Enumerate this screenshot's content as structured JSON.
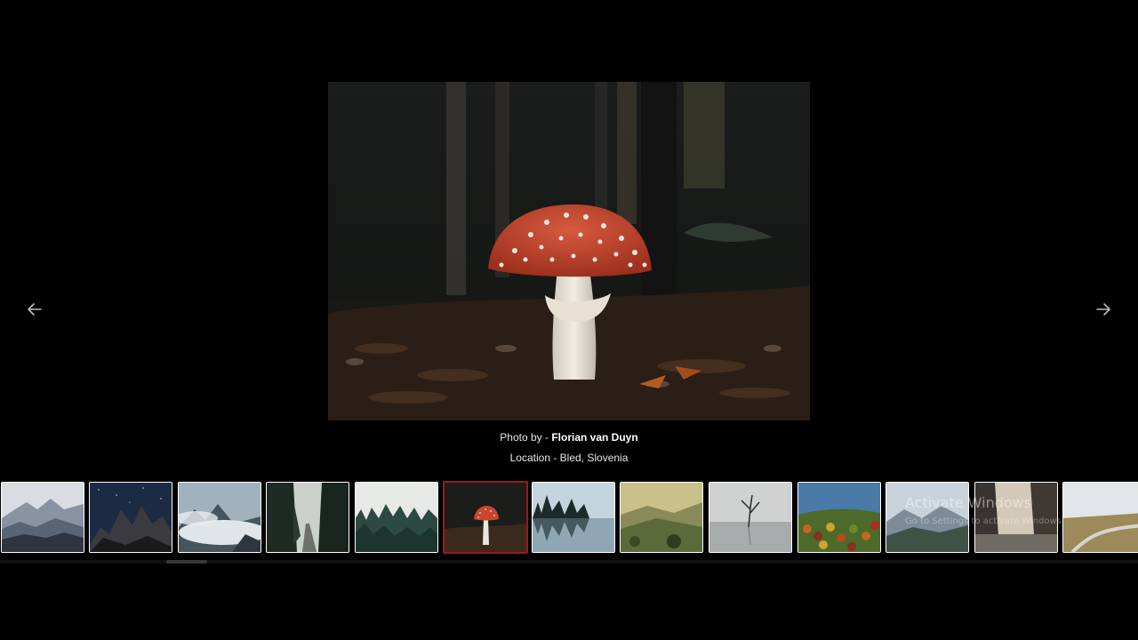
{
  "caption": {
    "credit_prefix": "Photo by - ",
    "photographer": "Florian van Duyn",
    "location": "Location - Bled, Slovenia"
  },
  "navigation": {
    "prev_icon": "arrow-left-icon",
    "next_icon": "arrow-right-icon"
  },
  "gallery": {
    "active_index": 5,
    "active_border_color": "#a01818",
    "thumbnails": [
      {
        "subject": "misty-mountain-ridges"
      },
      {
        "subject": "starry-night-peaks"
      },
      {
        "subject": "cloudy-mountains"
      },
      {
        "subject": "foggy-forest-road"
      },
      {
        "subject": "misty-pine-forest"
      },
      {
        "subject": "red-mushroom"
      },
      {
        "subject": "lake-tree-reflection"
      },
      {
        "subject": "sunlit-valley"
      },
      {
        "subject": "lone-tree-in-lake"
      },
      {
        "subject": "autumn-forest-aerial"
      },
      {
        "subject": "mountain-lake-valley"
      },
      {
        "subject": "coastal-cliffs"
      },
      {
        "subject": "coastal-road"
      }
    ]
  },
  "watermark": {
    "title": "Activate Windows",
    "subtitle": "Go to Settings to activate Windows."
  }
}
